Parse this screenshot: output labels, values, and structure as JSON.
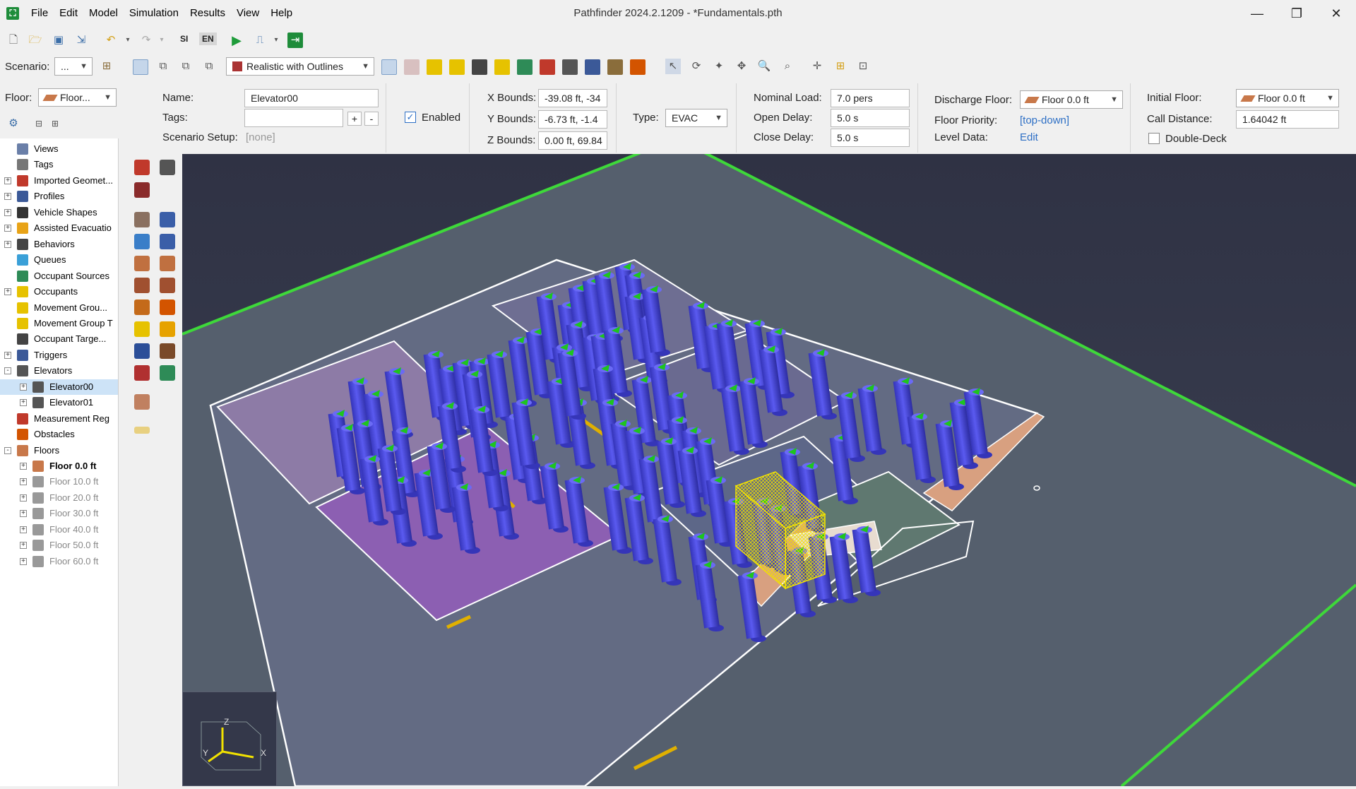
{
  "app": {
    "title": "Pathfinder 2024.2.1209 - *Fundamentals.pth",
    "menu": [
      "File",
      "Edit",
      "Model",
      "Simulation",
      "Results",
      "View",
      "Help"
    ]
  },
  "toolbar": {
    "units_si": "SI",
    "units_en": "EN",
    "scenario_label": "Scenario:",
    "scenario_value": "...",
    "render_mode": "Realistic with Outlines"
  },
  "floor_selector": {
    "label": "Floor:",
    "value": "Floor..."
  },
  "properties": {
    "name_label": "Name:",
    "name_value": "Elevator00",
    "tags_label": "Tags:",
    "tags_value": "",
    "tags_add": "+",
    "tags_remove": "-",
    "scenario_setup_label": "Scenario Setup:",
    "scenario_setup_value": "[none]",
    "enabled_label": "Enabled",
    "x_bounds_label": "X Bounds:",
    "x_bounds_value": "-39.08 ft, -34",
    "y_bounds_label": "Y Bounds:",
    "y_bounds_value": "-6.73 ft, -1.4",
    "z_bounds_label": "Z Bounds:",
    "z_bounds_value": "0.00 ft, 69.84",
    "type_label": "Type:",
    "type_value": "EVAC",
    "nominal_load_label": "Nominal Load:",
    "nominal_load_value": "7.0 pers",
    "open_delay_label": "Open Delay:",
    "open_delay_value": "5.0 s",
    "close_delay_label": "Close Delay:",
    "close_delay_value": "5.0 s",
    "discharge_floor_label": "Discharge Floor:",
    "discharge_floor_value": "Floor 0.0 ft",
    "floor_priority_label": "Floor Priority:",
    "floor_priority_value": "[top-down]",
    "level_data_label": "Level Data:",
    "level_data_value": "Edit",
    "initial_floor_label": "Initial Floor:",
    "initial_floor_value": "Floor 0.0 ft",
    "call_distance_label": "Call Distance:",
    "call_distance_value": "1.64042 ft",
    "double_deck_label": "Double-Deck"
  },
  "tree": [
    {
      "label": "Views",
      "indent": 0,
      "exp": "",
      "icon": "#6a7fa8"
    },
    {
      "label": "Tags",
      "indent": 0,
      "exp": "",
      "icon": "#777"
    },
    {
      "label": "Imported Geomet...",
      "indent": 0,
      "exp": "+",
      "icon": "#c0392b"
    },
    {
      "label": "Profiles",
      "indent": 0,
      "exp": "+",
      "icon": "#3b5998"
    },
    {
      "label": "Vehicle Shapes",
      "indent": 0,
      "exp": "+",
      "icon": "#333"
    },
    {
      "label": "Assisted Evacuatio",
      "indent": 0,
      "exp": "+",
      "icon": "#e8a317"
    },
    {
      "label": "Behaviors",
      "indent": 0,
      "exp": "+",
      "icon": "#444"
    },
    {
      "label": "Queues",
      "indent": 0,
      "exp": "",
      "icon": "#3aa0d8"
    },
    {
      "label": "Occupant Sources",
      "indent": 0,
      "exp": "",
      "icon": "#2e8b57"
    },
    {
      "label": "Occupants",
      "indent": 0,
      "exp": "+",
      "icon": "#e6c200"
    },
    {
      "label": "Movement Grou...",
      "indent": 0,
      "exp": "",
      "icon": "#e6c200"
    },
    {
      "label": "Movement Group T",
      "indent": 0,
      "exp": "",
      "icon": "#e6c200"
    },
    {
      "label": "Occupant Targe...",
      "indent": 0,
      "exp": "",
      "icon": "#444"
    },
    {
      "label": "Triggers",
      "indent": 0,
      "exp": "+",
      "icon": "#3b5998"
    },
    {
      "label": "Elevators",
      "indent": 0,
      "exp": "-",
      "icon": "#555"
    },
    {
      "label": "Elevator00",
      "indent": 1,
      "exp": "+",
      "icon": "#555",
      "selected": true
    },
    {
      "label": "Elevator01",
      "indent": 1,
      "exp": "+",
      "icon": "#555"
    },
    {
      "label": "Measurement Reg",
      "indent": 0,
      "exp": "",
      "icon": "#c0392b"
    },
    {
      "label": "Obstacles",
      "indent": 0,
      "exp": "",
      "icon": "#d35400"
    },
    {
      "label": "Floors",
      "indent": 0,
      "exp": "-",
      "icon": "#c8784a"
    },
    {
      "label": "Floor 0.0 ft",
      "indent": 1,
      "exp": "+",
      "icon": "#c8784a",
      "bold": true
    },
    {
      "label": "Floor 10.0 ft",
      "indent": 1,
      "exp": "+",
      "icon": "#999",
      "dim": true
    },
    {
      "label": "Floor 20.0 ft",
      "indent": 1,
      "exp": "+",
      "icon": "#999",
      "dim": true
    },
    {
      "label": "Floor 30.0 ft",
      "indent": 1,
      "exp": "+",
      "icon": "#999",
      "dim": true
    },
    {
      "label": "Floor 40.0 ft",
      "indent": 1,
      "exp": "+",
      "icon": "#999",
      "dim": true
    },
    {
      "label": "Floor 50.0 ft",
      "indent": 1,
      "exp": "+",
      "icon": "#999",
      "dim": true
    },
    {
      "label": "Floor 60.0 ft",
      "indent": 1,
      "exp": "+",
      "icon": "#999",
      "dim": true
    }
  ],
  "triad": {
    "z": "Z",
    "y": "Y",
    "x": "X"
  },
  "colors": {
    "ground": "#55606e",
    "sky": "#343849",
    "boundary": "#3ed83a",
    "occupant": "#4b4bd8",
    "occupant_head": "#1ec41e",
    "room_purple": "#8a64b0",
    "stair": "#d8a080",
    "elevator": "#f2e200",
    "selection": "#cde3f7",
    "link": "#2d6fc5"
  }
}
